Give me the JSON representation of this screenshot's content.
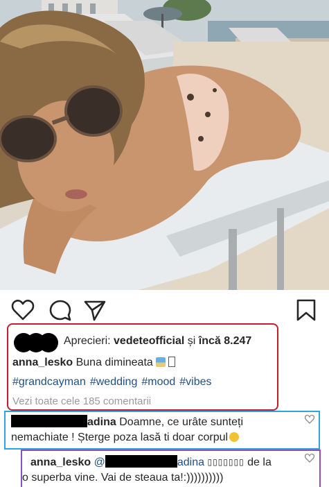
{
  "post": {
    "likes": {
      "prefix": "Aprecieri:",
      "first_liker": "vedeteofficial",
      "connector": "și",
      "others_count": "încă 8.247"
    },
    "caption": {
      "username": "anna_lesko",
      "text": "Buna dimineata"
    },
    "hashtags": [
      "#grandcayman",
      "#wedding",
      "#mood",
      "#vibes"
    ],
    "view_comments": "Vezi toate cele 185 comentarii"
  },
  "comments": [
    {
      "username": "adina",
      "line1": "Doamne, ce urâte sunteți",
      "line2": "nemachiate ! Șterge poza  lasă ti doar corpul"
    },
    {
      "username": "anna_lesko",
      "mention_prefix": "@",
      "mention_user": "adina",
      "glyphs": "▯▯▯▯▯▯▯",
      "line1_end": "de la",
      "line2": "o superba vine. Vai de steaua ta!:))))))))))"
    }
  ],
  "colors": {
    "likes_box": "#c0202b",
    "comment1_box": "#2ba7dc",
    "comment2_box": "#8e52b6",
    "hashtag": "#1f4f84"
  },
  "icons": [
    "heart-icon",
    "comment-icon",
    "share-icon",
    "bookmark-icon"
  ]
}
